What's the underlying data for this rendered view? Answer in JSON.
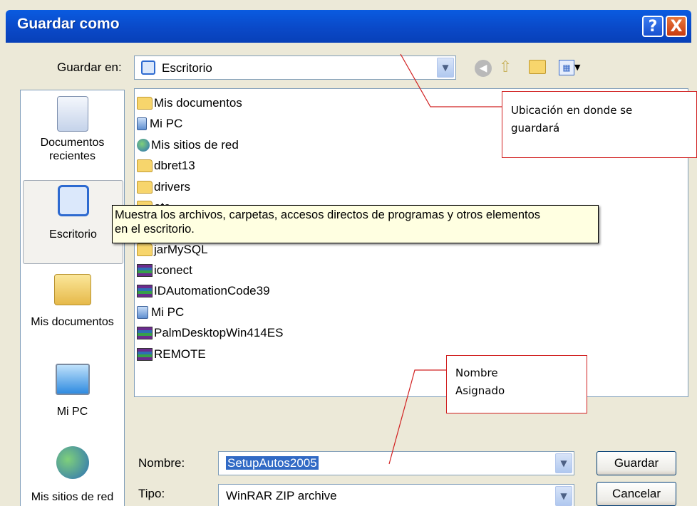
{
  "window": {
    "title": "Guardar como",
    "help_label": "?",
    "close_label": "X"
  },
  "location": {
    "label": "Guardar en:",
    "value": "Escritorio"
  },
  "toolbar": {
    "icons": [
      "back-icon",
      "up-folder-icon",
      "new-folder-icon",
      "views-menu-icon"
    ]
  },
  "places": [
    {
      "label": "Documentos recientes",
      "icon": "recent-documents-icon"
    },
    {
      "label": "Escritorio",
      "icon": "desktop-icon"
    },
    {
      "label": "Mis documentos",
      "icon": "my-documents-icon"
    },
    {
      "label": "Mi PC",
      "icon": "my-computer-icon"
    },
    {
      "label": "Mis sitios de red",
      "icon": "network-places-icon"
    }
  ],
  "files": [
    {
      "name": "Mis documentos",
      "icon": "folder-icon"
    },
    {
      "name": "Mi PC",
      "icon": "computer-icon"
    },
    {
      "name": "Mis sitios de red",
      "icon": "network-icon"
    },
    {
      "name": "dbret13",
      "icon": "folder-icon"
    },
    {
      "name": "drivers",
      "icon": "folder-icon"
    },
    {
      "name": "etc",
      "icon": "folder-icon"
    },
    {
      "name": "",
      "icon": "folder-icon"
    },
    {
      "name": "jarMySQL",
      "icon": "folder-icon"
    },
    {
      "name": "iconect",
      "icon": "winrar-archive-icon"
    },
    {
      "name": "IDAutomationCode39",
      "icon": "winrar-archive-icon"
    },
    {
      "name": "Mi PC",
      "icon": "shortcut-computer-icon"
    },
    {
      "name": "PalmDesktopWin414ES",
      "icon": "winrar-archive-icon"
    },
    {
      "name": "REMOTE",
      "icon": "winrar-archive-icon"
    }
  ],
  "tooltip": {
    "line1": "Muestra los archivos, carpetas, accesos directos de programas y otros elementos",
    "line2": "en el escritorio."
  },
  "filename": {
    "label": "Nombre:",
    "value": "SetupAutos2005"
  },
  "filetype": {
    "label": "Tipo:",
    "value": "WinRAR ZIP archive"
  },
  "buttons": {
    "save": "Guardar",
    "cancel": "Cancelar"
  },
  "annotations": {
    "location_line1": "Ubicación en donde se",
    "location_line2": "guardará",
    "name_line1": "Nombre",
    "name_line2": "Asignado"
  },
  "colors": {
    "titlebar": "#0a49c8",
    "annotation_border": "#d12020",
    "selection": "#316ac5"
  }
}
